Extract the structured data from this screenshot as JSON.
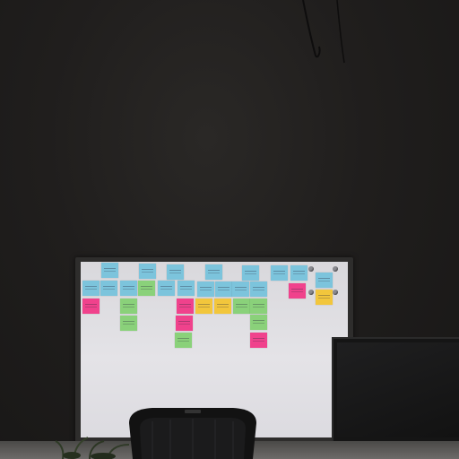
{
  "scene": {
    "description_tags": [
      "dark-wall",
      "whiteboard",
      "sticky-notes",
      "monitor",
      "office-chair",
      "plant"
    ],
    "colors": {
      "wall": "#201e1d",
      "whiteboard": "#e0dfe3",
      "frame": "#2e2d2c",
      "note_blue": "#7cc4dc",
      "note_green": "#8ad17a",
      "note_pink": "#f0428c",
      "note_yellow": "#f2c63c",
      "monitor": "#151515",
      "desk": "#5a5957"
    }
  }
}
